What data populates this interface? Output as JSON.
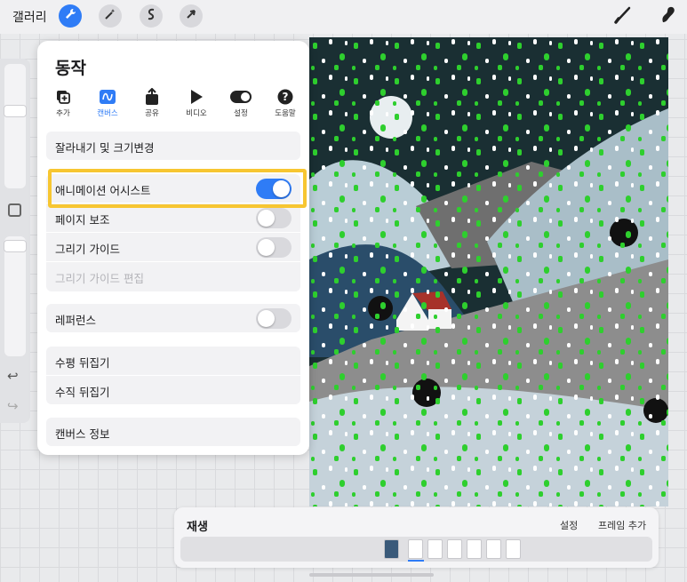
{
  "topbar": {
    "gallery_label": "갤러리",
    "tools": [
      "wrench-icon",
      "magic-wand-icon",
      "selection-s-icon",
      "transform-arrow-icon"
    ],
    "right_tools": [
      "brush-icon",
      "smudge-icon"
    ],
    "accent": "#2f7cf6"
  },
  "panel": {
    "title": "동작",
    "tabs": [
      {
        "label": "추가",
        "icon": "add-layer-icon"
      },
      {
        "label": "캔버스",
        "icon": "canvas-icon",
        "active": true
      },
      {
        "label": "공유",
        "icon": "share-icon"
      },
      {
        "label": "비디오",
        "icon": "play-icon"
      },
      {
        "label": "설정",
        "icon": "toggle-icon"
      },
      {
        "label": "도움말",
        "icon": "help-icon"
      }
    ],
    "crop_resize": "잘라내기 및 크기변경",
    "animation_assist": {
      "label": "애니메이션 어시스트",
      "on": true
    },
    "page_assist": {
      "label": "페이지 보조",
      "on": false
    },
    "drawing_guide": {
      "label": "그리기 가이드",
      "on": false
    },
    "edit_drawing_guide": "그리기 가이드 편집",
    "reference": {
      "label": "레퍼런스",
      "on": false
    },
    "flip_horizontal": "수평 뒤집기",
    "flip_vertical": "수직 뒤집기",
    "canvas_info": "캔버스 정보"
  },
  "timeline": {
    "title": "재생",
    "settings": "설정",
    "add_frame": "프레임 추가"
  }
}
